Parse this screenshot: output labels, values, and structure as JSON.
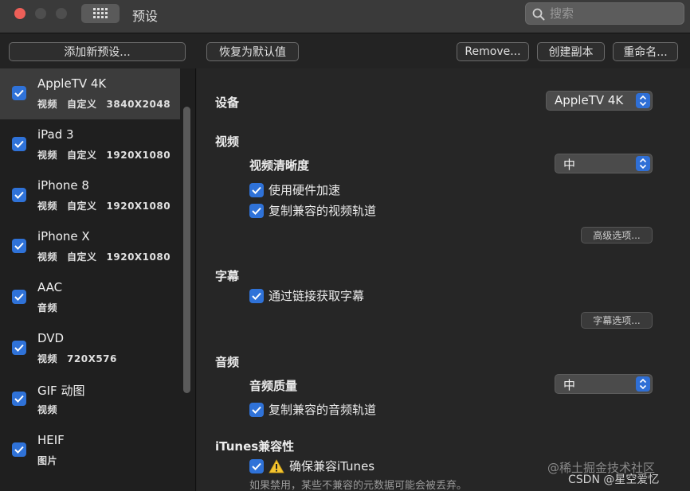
{
  "window": {
    "title": "预设"
  },
  "search": {
    "placeholder": "搜索"
  },
  "toolbar": {
    "add_preset": "添加新预设...",
    "restore_defaults": "恢复为默认值",
    "remove": "Remove...",
    "duplicate": "创建副本",
    "rename": "重命名..."
  },
  "sidebar": {
    "items": [
      {
        "name": "AppleTV 4K",
        "meta": [
          "视频",
          "自定义",
          "3840X2048"
        ],
        "checked": true,
        "selected": true
      },
      {
        "name": "iPad 3",
        "meta": [
          "视频",
          "自定义",
          "1920X1080"
        ],
        "checked": true
      },
      {
        "name": "iPhone 8",
        "meta": [
          "视频",
          "自定义",
          "1920X1080"
        ],
        "checked": true
      },
      {
        "name": "iPhone X",
        "meta": [
          "视频",
          "自定义",
          "1920X1080"
        ],
        "checked": true
      },
      {
        "name": "AAC",
        "meta": [
          "音频"
        ],
        "checked": true
      },
      {
        "name": "DVD",
        "meta": [
          "视频",
          "720X576"
        ],
        "checked": true
      },
      {
        "name": "GIF 动图",
        "meta": [
          "视频"
        ],
        "checked": true
      },
      {
        "name": "HEIF",
        "meta": [
          "图片"
        ],
        "checked": true
      }
    ]
  },
  "main": {
    "device_label": "设备",
    "device_value": "AppleTV 4K",
    "video": {
      "section": "视频",
      "quality_label": "视频清晰度",
      "quality_value": "中",
      "hw_accel": "使用硬件加速",
      "copy_video_track": "复制兼容的视频轨道",
      "advanced_button": "高级选项..."
    },
    "subtitles": {
      "section": "字幕",
      "fetch_via_link": "通过链接获取字幕",
      "options_button": "字幕选项..."
    },
    "audio": {
      "section": "音频",
      "quality_label": "音频质量",
      "quality_value": "中",
      "copy_audio_track": "复制兼容的音频轨道"
    },
    "itunes": {
      "section": "iTunes兼容性",
      "ensure": "确保兼容iTunes",
      "hint": "如果禁用，某些不兼容的元数据可能会被丢弃。"
    }
  },
  "watermark": {
    "line1": "@稀土掘金技术社区",
    "line2": "CSDN @星空爱忆"
  },
  "colors": {
    "accent": "#2f72d8",
    "close": "#ed5f58"
  }
}
